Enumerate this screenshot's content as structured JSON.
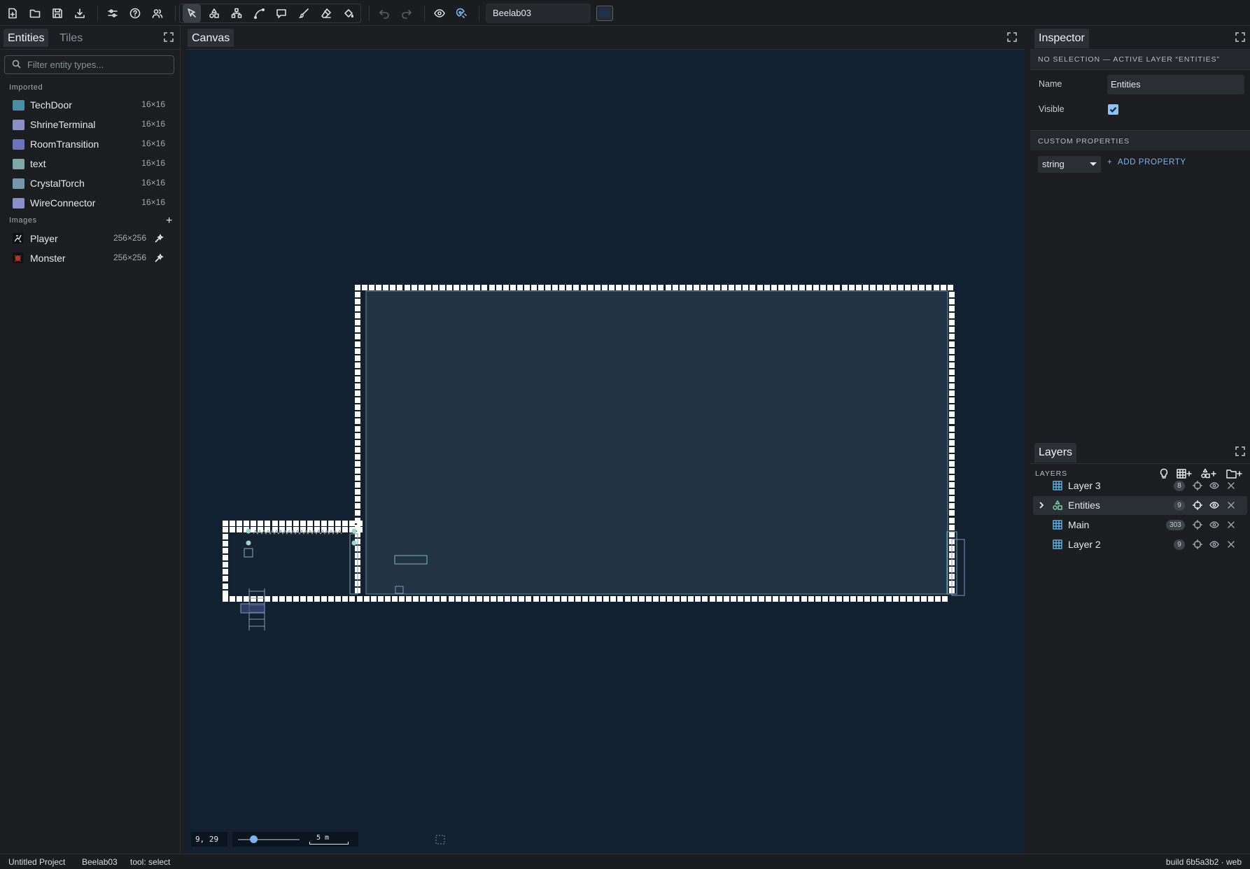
{
  "toolbar": {
    "file_icons": [
      "new-file-icon",
      "open-folder-icon",
      "save-icon",
      "download-icon"
    ],
    "tool_icons": [
      "select-icon",
      "shapes-icon",
      "waypoint-icon",
      "path-icon",
      "comment-icon",
      "brush-icon",
      "eraser-icon",
      "fill-icon"
    ],
    "map_name": "Beelab03",
    "background_color": "#1f2f45"
  },
  "left_panel": {
    "tabs": [
      "Entities",
      "Tiles"
    ],
    "filter_placeholder": "Filter entity types...",
    "imported_label": "Imported",
    "entities": [
      {
        "name": "TechDoor",
        "size": "16×16",
        "color": "#4a8fa3"
      },
      {
        "name": "ShrineTerminal",
        "size": "16×16",
        "color": "#8a8fc8"
      },
      {
        "name": "RoomTransition",
        "size": "16×16",
        "color": "#6d72bd"
      },
      {
        "name": "text",
        "size": "16×16",
        "color": "#7fa8a8"
      },
      {
        "name": "CrystalTorch",
        "size": "16×16",
        "color": "#7398a8"
      },
      {
        "name": "WireConnector",
        "size": "16×16",
        "color": "#8a8fcc"
      }
    ],
    "images_label": "Images",
    "images": [
      {
        "name": "Player",
        "size": "256×256"
      },
      {
        "name": "Monster",
        "size": "256×256"
      }
    ]
  },
  "canvas": {
    "tab": "Canvas",
    "coords": "9, 29",
    "scale_label": "5 m",
    "zoom_level": 0.25
  },
  "inspector": {
    "tab": "Inspector",
    "banner": "NO SELECTION — ACTIVE LAYER “ENTITIES”",
    "name_label": "Name",
    "name_value": "Entities",
    "visible_label": "Visible",
    "visible_checked": true,
    "custom_props_label": "CUSTOM PROPERTIES",
    "type_value": "string",
    "add_property": "ADD PROPERTY"
  },
  "layers": {
    "tab": "Layers",
    "label": "LAYERS",
    "items": [
      {
        "name": "Layer 3",
        "count": "8",
        "kind": "tile",
        "selected": false
      },
      {
        "name": "Entities",
        "count": "9",
        "kind": "entity",
        "selected": true
      },
      {
        "name": "Main",
        "count": "303",
        "kind": "tile",
        "selected": false
      },
      {
        "name": "Layer 2",
        "count": "9",
        "kind": "tile",
        "selected": false
      }
    ]
  },
  "status": {
    "project": "Untitled Project",
    "map": "Beelab03",
    "tool": "tool: select",
    "build": "build 6b5a3b2 · web"
  }
}
